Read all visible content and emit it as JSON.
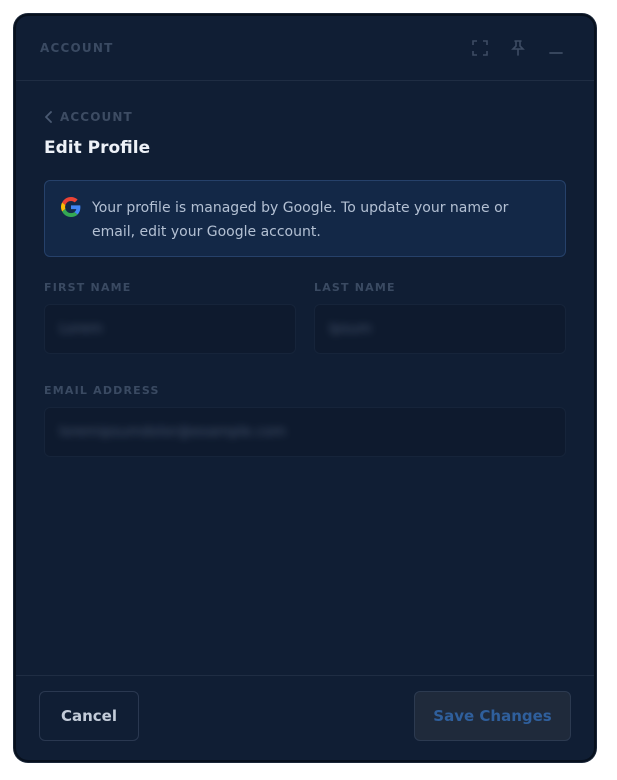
{
  "titlebar": {
    "label": "ACCOUNT",
    "controls": [
      {
        "name": "expand-icon"
      },
      {
        "name": "pin-icon"
      },
      {
        "name": "minimize-icon"
      }
    ]
  },
  "breadcrumb": {
    "back_icon": "chevron-left-icon",
    "label": "ACCOUNT"
  },
  "page": {
    "title": "Edit Profile"
  },
  "notice": {
    "icon": "google-logo-icon",
    "text": "Your profile is managed by Google. To update your name or email, edit your Google account."
  },
  "form": {
    "first_name": {
      "label": "FIRST NAME",
      "value": "Lorem"
    },
    "last_name": {
      "label": "LAST NAME",
      "value": "Ipsum"
    },
    "email": {
      "label": "EMAIL ADDRESS",
      "value": "loremipsumdolor@example.com"
    }
  },
  "footer": {
    "cancel_label": "Cancel",
    "save_label": "Save Changes"
  },
  "colors": {
    "background": "#101e34",
    "notice_bg": "#132847",
    "save_text": "#2f5f9c"
  }
}
